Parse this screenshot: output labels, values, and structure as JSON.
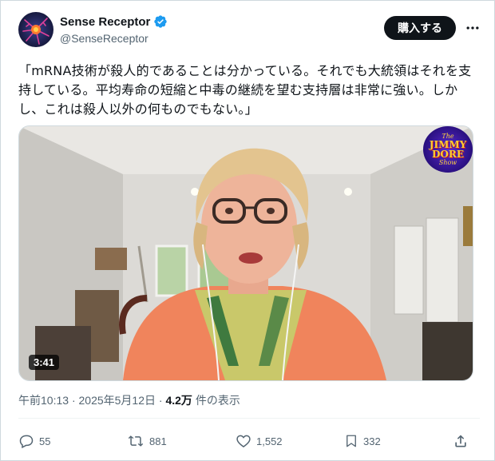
{
  "author": {
    "display_name": "Sense Receptor",
    "handle": "@SenseReceptor",
    "verified": true,
    "verified_color": "#1d9bf0"
  },
  "header": {
    "buy_label": "購入する",
    "more_icon": "more-horizontal-icon"
  },
  "tweet": {
    "text": "「mRNA技術が殺人的であることは分かっている。それでも大統領はそれを支持している。平均寿命の短縮と中毒の継続を望む支持層は非常に強い。しかし、これは殺人以外の何ものでもない。」"
  },
  "media": {
    "duration": "3:41",
    "watermark": {
      "line1": "The",
      "line2": "JIMMY DORE",
      "line3": "Show"
    }
  },
  "meta": {
    "time": "午前10:13",
    "separator1": "·",
    "date": "2025年5月12日",
    "separator2": "·",
    "views": "4.2万",
    "views_suffix": "件の表示"
  },
  "actions": {
    "replies": "55",
    "reposts": "881",
    "likes": "1,552",
    "bookmarks": "332"
  },
  "colors": {
    "text": "#0f1419",
    "secondary": "#536471",
    "button_bg": "#0f1419",
    "border": "#cfd9de"
  }
}
